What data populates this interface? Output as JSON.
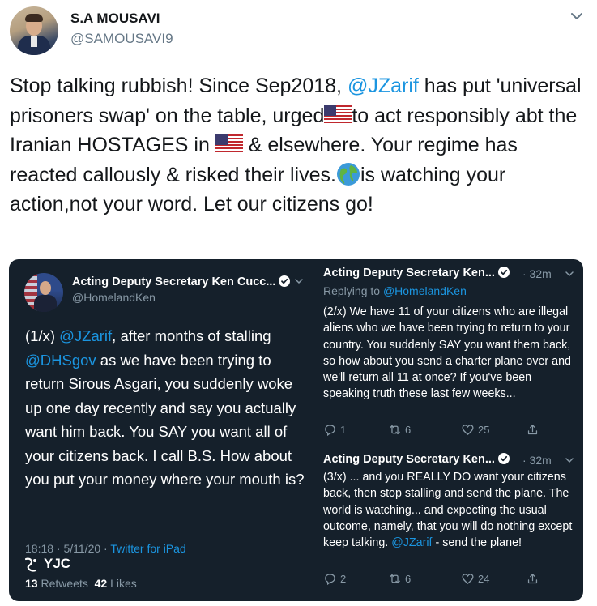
{
  "author": {
    "name": "S.A MOUSAVI",
    "handle": "@SAMOUSAVI9"
  },
  "tweet": {
    "t1": "Stop talking rubbish! Since Sep2018, ",
    "m1": "@JZarif",
    "t2": " has put 'universal prisoners swap' on the table, urged",
    "t3": "to act responsibly abt the Iranian HOSTAGES in ",
    "t4": " & elsewhere. Your regime has reacted callously & risked their lives.",
    "t5": "is watching your action,not your word. Let our citizens go!"
  },
  "screenshot": {
    "left": {
      "display_name": "Acting Deputy Secretary Ken Cucc...",
      "handle": "@HomelandKen",
      "b1": "(1/x) ",
      "m1": "@JZarif",
      "b2": ", after months of stalling ",
      "m2": "@DHSgov",
      "b3": " as we have been trying to return Sirous Asgari, you suddenly woke up one day recently and say you actually want him back. You SAY you want all of your citizens back. I call B.S. How about you put your money where your mouth is?",
      "time": "18:18 · 5/11/20 · ",
      "source": "Twitter for iPad",
      "retweets_count": "13",
      "retweets_label": "Retweets",
      "likes_count": "42",
      "likes_label": "Likes",
      "watermark": "YJC"
    },
    "right": [
      {
        "display_name": "Acting Deputy Secretary Ken...",
        "age": "· 32m",
        "replying_label": "Replying to ",
        "replying_to": "@HomelandKen",
        "text": "(2/x) We have 11 of your citizens who are illegal aliens who we have been trying to return to your country. You suddenly SAY you want them back, so how about you send a charter plane over and we'll return all 11 at once? If you've been speaking truth these last few weeks...",
        "replies": "1",
        "retweets": "6",
        "likes": "25"
      },
      {
        "display_name": "Acting Deputy Secretary Ken...",
        "age": "· 32m",
        "text": "(3/x) ... and you REALLY DO want your citizens back, then stop stalling and send the plane. The world is watching... and expecting the usual outcome, namely, that you will do nothing except keep talking. ",
        "mention": "@JZarif",
        "text_end": " - send the plane!",
        "replies": "2",
        "retweets": "6",
        "likes": "24"
      }
    ]
  },
  "colors": {
    "link": "#1b95e0",
    "dark_bg": "#15202b",
    "muted": "#8899a6",
    "text": "#14171a"
  },
  "icons": [
    "chevron-down-icon",
    "verified-icon",
    "reply-icon",
    "retweet-icon",
    "like-icon",
    "share-icon",
    "us-flag-emoji",
    "globe-emoji"
  ]
}
